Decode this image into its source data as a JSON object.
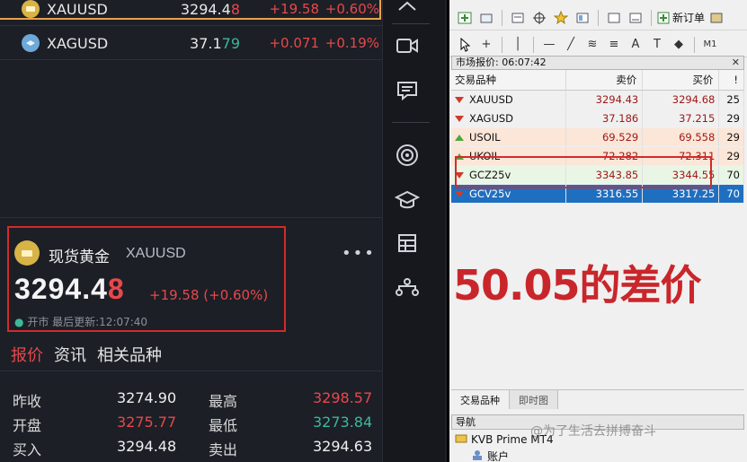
{
  "left": {
    "quotes": [
      {
        "symbol": "XAUUSD",
        "price_main": "3294.4",
        "price_last": "8",
        "change": "+19.58",
        "pct": "+0.60%"
      },
      {
        "symbol": "XAGUSD",
        "price_main": "37.1",
        "price_last": "79",
        "change": "+0.071",
        "pct": "+0.19%"
      }
    ],
    "detail": {
      "name": "现货黄金",
      "code": "XAUUSD",
      "price_main": "3294.4",
      "price_last": "8",
      "change": "+19.58 (+0.60%)",
      "status_dot": "●",
      "status": "开市 最后更新:12:07:40",
      "more": "•••"
    },
    "tabs": [
      "报价",
      "资讯",
      "相关品种"
    ],
    "stats": [
      {
        "label": "昨收",
        "value": "3274.90",
        "label2": "最高",
        "value2": "3298.57"
      },
      {
        "label": "开盘",
        "value": "3275.77",
        "label2": "最低",
        "value2": "3273.84"
      },
      {
        "label": "买入",
        "value": "3294.48",
        "label2": "卖出",
        "value2": "3294.63"
      }
    ],
    "colors": {
      "up": "#e8484b",
      "down": "#3db89a",
      "gold": "#d8b346"
    }
  },
  "mt4": {
    "new_order": "新订单",
    "toolbar2_right": "M1",
    "market_watch_title": "市场报价: 06:07:42",
    "columns": [
      "交易品种",
      "卖价",
      "买价",
      "!"
    ],
    "rows": [
      {
        "symbol": "XAUUSD",
        "bid": "3294.43",
        "ask": "3294.68",
        "spread": "25",
        "dir": "dn",
        "style": "r-white"
      },
      {
        "symbol": "XAGUSD",
        "bid": "37.186",
        "ask": "37.215",
        "spread": "29",
        "dir": "dn",
        "style": "r-white"
      },
      {
        "symbol": "USOIL",
        "bid": "69.529",
        "ask": "69.558",
        "spread": "29",
        "dir": "up",
        "style": "r-peach"
      },
      {
        "symbol": "UKOIL",
        "bid": "72.282",
        "ask": "72.311",
        "spread": "29",
        "dir": "up",
        "style": "r-peach"
      },
      {
        "symbol": "GCZ25v",
        "bid": "3343.85",
        "ask": "3344.55",
        "spread": "70",
        "dir": "dn",
        "style": "r-green"
      },
      {
        "symbol": "GCV25v",
        "bid": "3316.55",
        "ask": "3317.25",
        "spread": "70",
        "dir": "dn",
        "style": "r-sel"
      }
    ],
    "annotation": "50.05的差价",
    "bottom_tabs": [
      "交易品种",
      "即时图"
    ],
    "navigator_title": "导航",
    "nav_items": [
      "KVB Prime MT4",
      "账户"
    ]
  },
  "watermark": "@为了生活去拼搏奋斗"
}
